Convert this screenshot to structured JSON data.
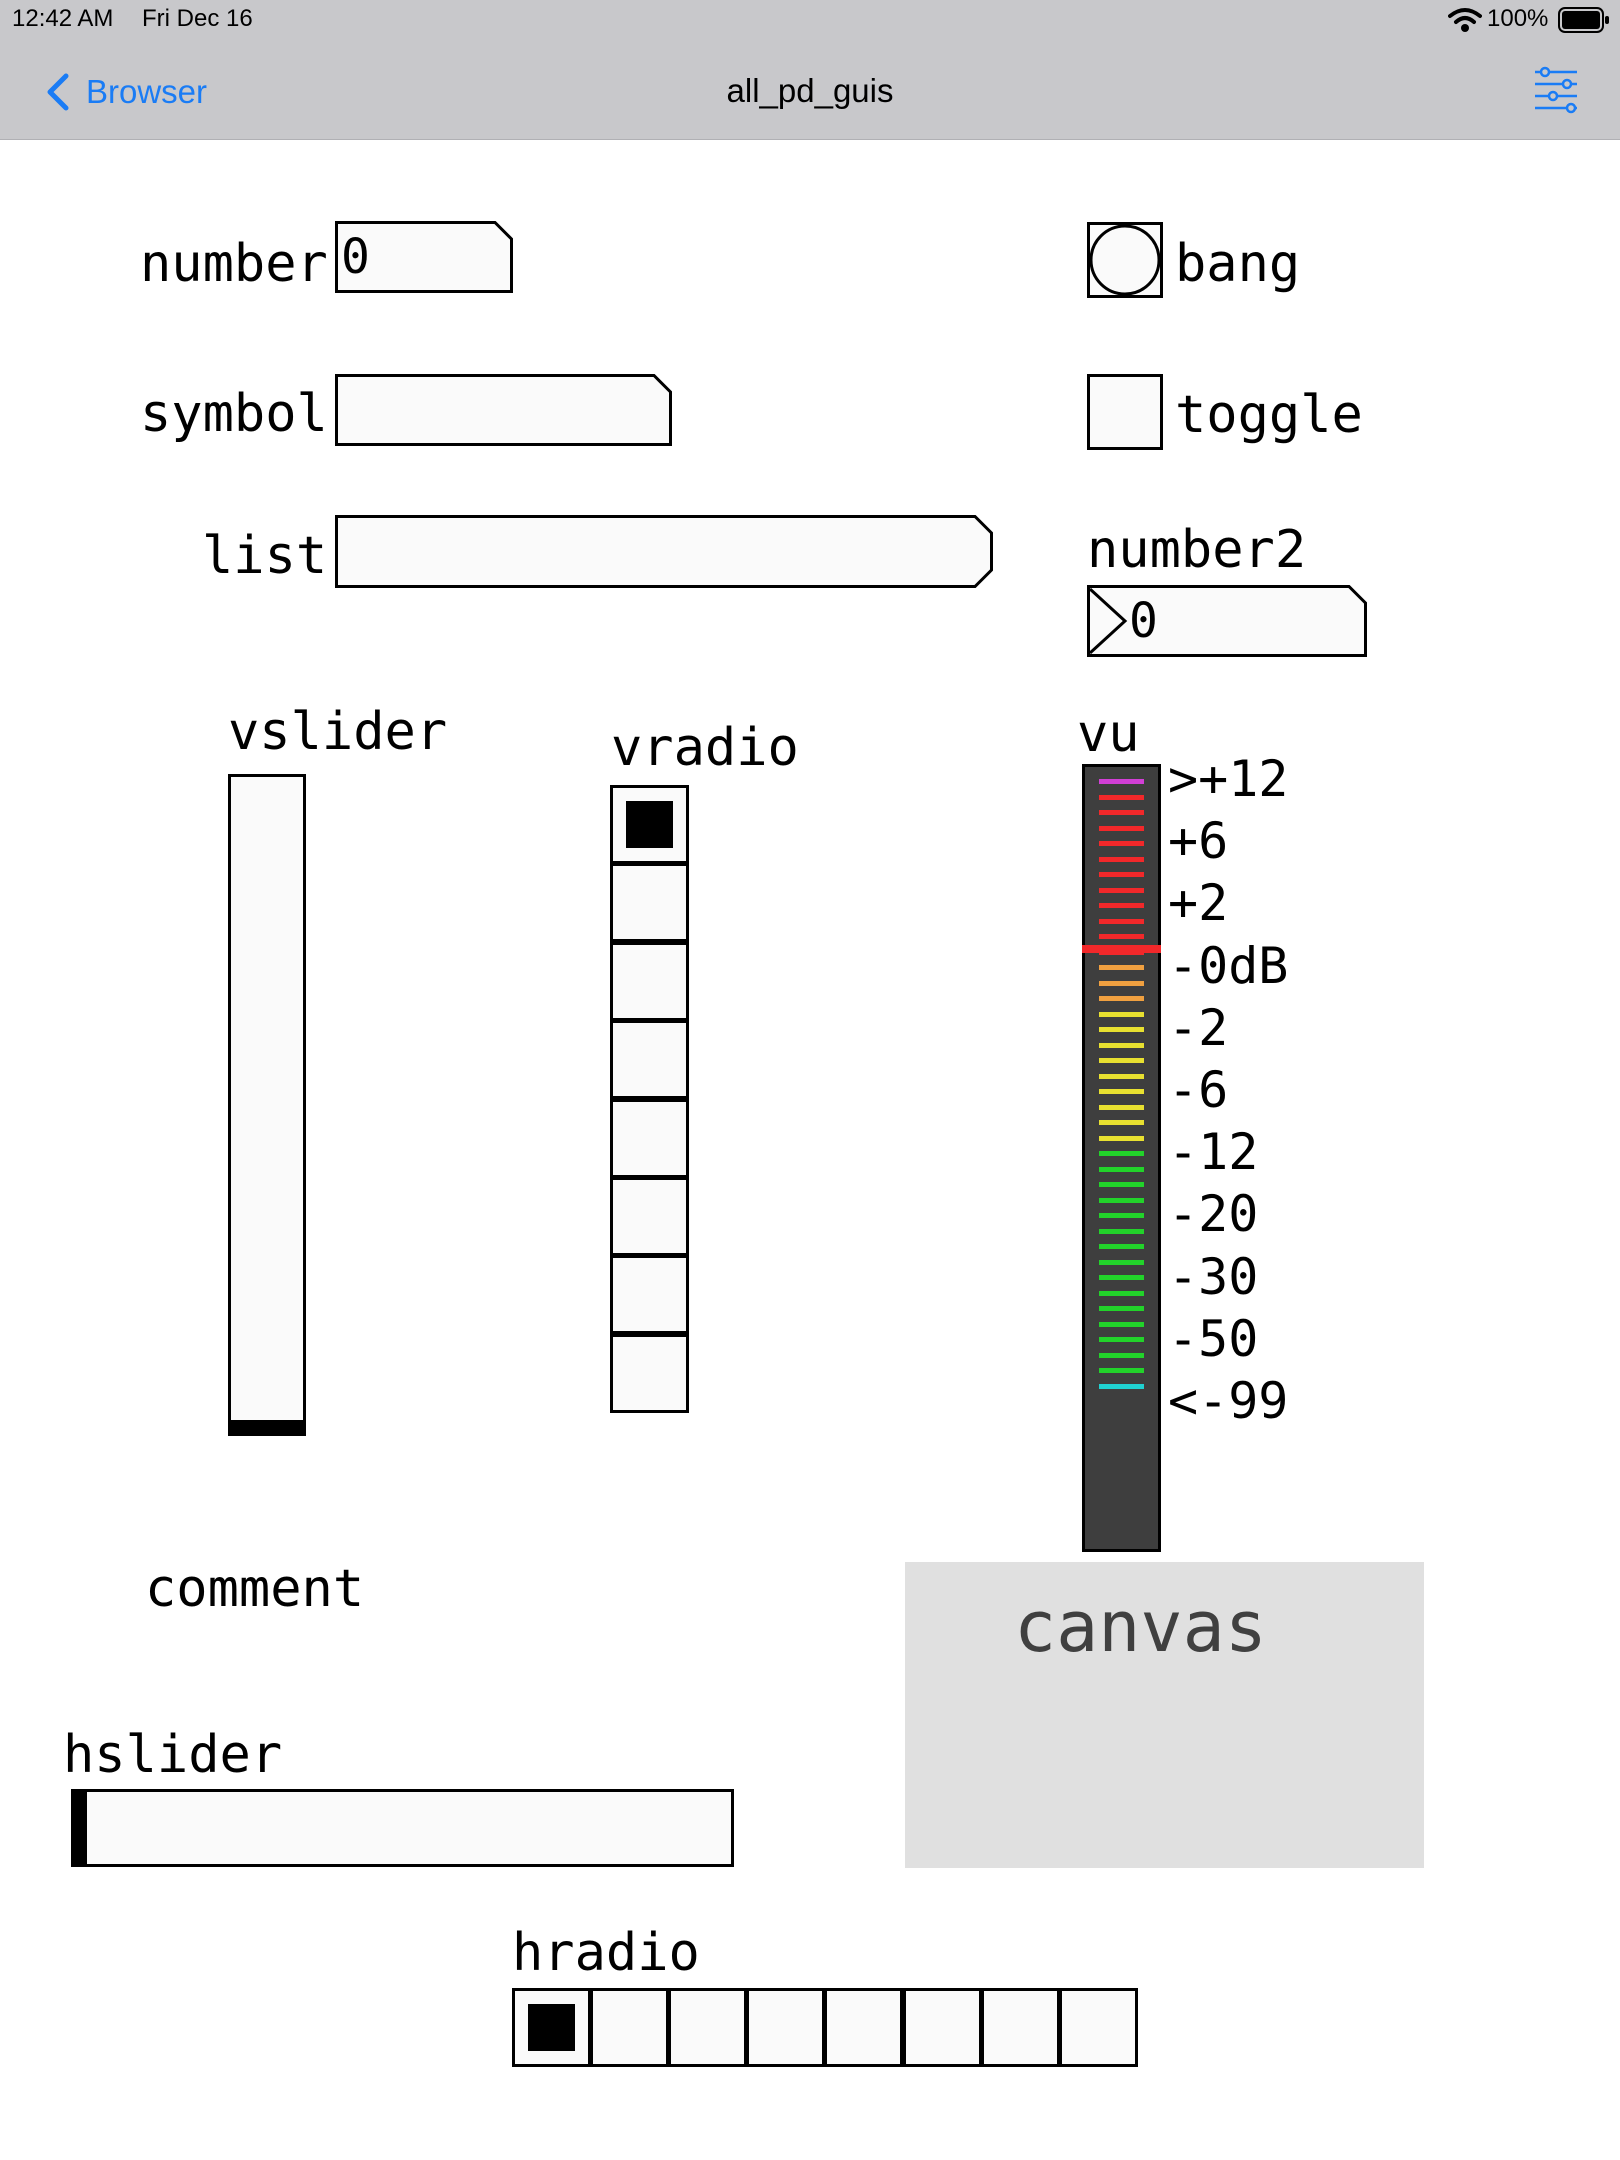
{
  "status_bar": {
    "time": "12:42 AM",
    "date": "Fri Dec 16",
    "battery": "100%"
  },
  "nav": {
    "back_label": "Browser",
    "title": "all_pd_guis",
    "back_icon": "chevron-left-icon",
    "settings_icon": "sliders-icon",
    "accent": "#1a7cf5"
  },
  "patch": {
    "number": {
      "label": "number",
      "value": "0"
    },
    "symbol": {
      "label": "symbol",
      "value": ""
    },
    "list": {
      "label": "list",
      "value": ""
    },
    "bang": {
      "label": "bang"
    },
    "toggle": {
      "label": "toggle",
      "state": false
    },
    "number2": {
      "label": "number2",
      "value": "0"
    },
    "vslider": {
      "label": "vslider",
      "value": 0
    },
    "vradio": {
      "label": "vradio",
      "count": 8,
      "selected": 0
    },
    "vu": {
      "label": "vu",
      "scale": [
        ">+12",
        "+6",
        "+2",
        "-0dB",
        "-2",
        "-6",
        "-12",
        "-20",
        "-30",
        "-50",
        "<-99"
      ],
      "level_colors": {
        "top": "#d23fd6",
        "red": "#f2282a",
        "orange": "#f0a040",
        "yellow": "#e8e030",
        "green": "#22d22a",
        "bottom": "#20d0d0"
      }
    },
    "comment": {
      "text": "comment"
    },
    "canvas": {
      "text": "canvas",
      "color": "#e0e0e0"
    },
    "hslider": {
      "label": "hslider",
      "value": 0
    },
    "hradio": {
      "label": "hradio",
      "count": 8,
      "selected": 0
    }
  }
}
